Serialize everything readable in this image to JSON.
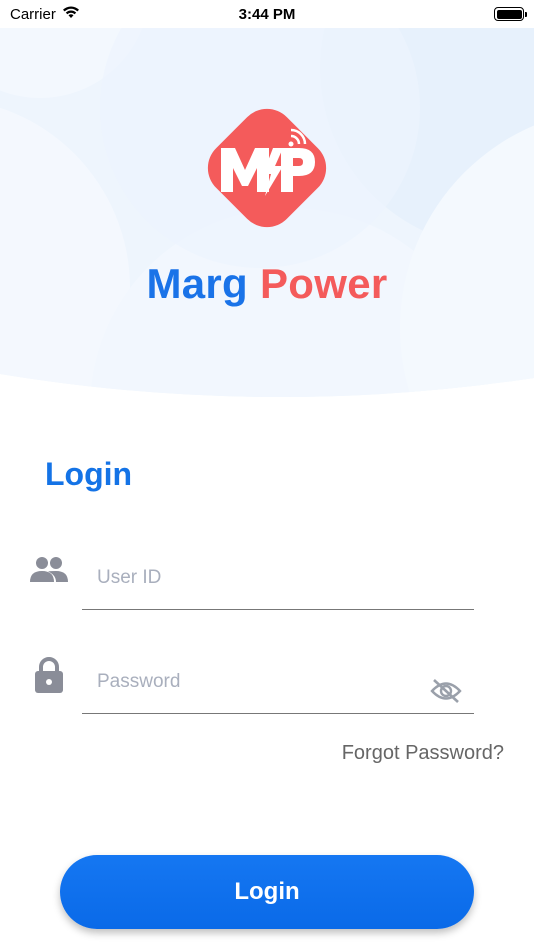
{
  "status_bar": {
    "carrier": "Carrier",
    "time": "3:44 PM"
  },
  "brand": {
    "name_part1": "Marg",
    "name_part2": "Power",
    "logo_text": "MP",
    "color_primary": "#1a73e8",
    "color_accent": "#f45b5b"
  },
  "login": {
    "title": "Login",
    "user_id_placeholder": "User ID",
    "password_placeholder": "Password",
    "forgot_password": "Forgot Password?",
    "login_button": "Login"
  },
  "icons": {
    "user": "users-icon",
    "lock": "lock-icon",
    "eye": "eye-off-icon",
    "wifi": "wifi-icon",
    "battery": "battery-icon"
  }
}
